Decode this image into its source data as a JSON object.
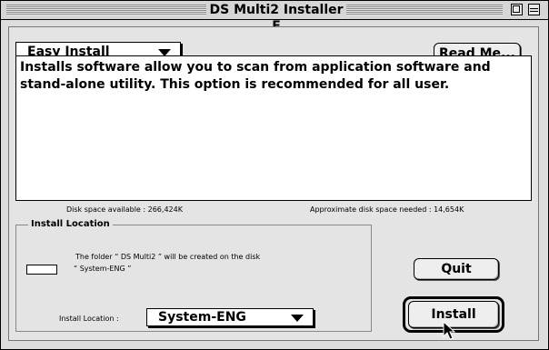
{
  "window": {
    "title": "DS Multi2 Installer E"
  },
  "install_mode": {
    "selected": "Easy Install"
  },
  "buttons": {
    "read_me": "Read Me...",
    "quit": "Quit",
    "install": "Install"
  },
  "description": "Installs software allow you to scan from application software and stand-alone utility. This option is recommended for all user.",
  "disk": {
    "available": "Disk space available : 266,424K",
    "needed": "Approximate disk space needed : 14,654K"
  },
  "install_location": {
    "group_title": "Install Location",
    "folder_line1": "The folder “ DS Multi2 ” will be created on the disk",
    "folder_line2": "“ System-ENG ”",
    "field_label": "Install Location :",
    "selected": "System-ENG"
  },
  "icons": [
    "zoom-box-icon",
    "collapse-box-icon",
    "popup-arrow-icon",
    "disk-icon",
    "mouse-pointer-icon"
  ]
}
